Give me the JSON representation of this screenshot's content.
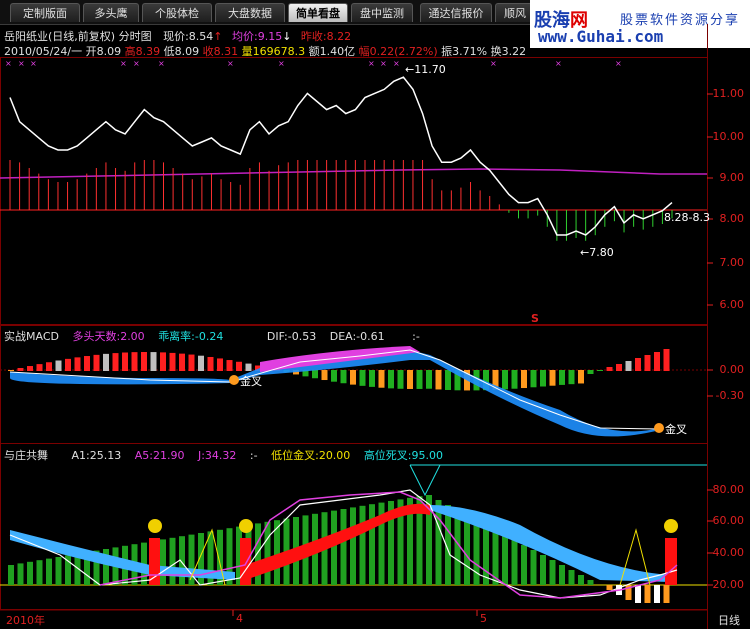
{
  "tabs": [
    {
      "label": "定制版面"
    },
    {
      "label": "多头鹰"
    },
    {
      "label": "个股体检"
    },
    {
      "label": "大盘数据"
    },
    {
      "label": "简单看盘",
      "active": true
    },
    {
      "label": "盘中监测"
    },
    {
      "label": "通达信报价"
    },
    {
      "label": "顺风"
    }
  ],
  "watermark": {
    "brand_cn_a": "股海",
    "brand_cn_b": "网",
    "slogan": "股票软件资源分享",
    "url": "www.Guhai.com"
  },
  "stock_header": {
    "name": "岳阳纸业(日线,前复权) 分时图",
    "price_label": "现价:8.54",
    "avg_label": "均价:9.15",
    "prev_close_label": "昨收:8.22"
  },
  "quote_row": {
    "date": "2010/05/24/一",
    "open": "开8.09",
    "high": "高8.39",
    "low": "低8.09",
    "close": "收8.31",
    "volume": "量169678.3",
    "amount": "额1.40亿",
    "change": "幅0.22(2.72%)",
    "amplitude": "振3.71%",
    "turnover": "换3.22"
  },
  "main_chart": {
    "y_ticks": [
      "11.00",
      "10.00",
      "9.00",
      "8.00",
      "7.00",
      "6.00"
    ],
    "high_marker": "11.70",
    "low_marker": "7.80",
    "range_label": "8.28-8.3",
    "sell_marker": "S"
  },
  "macd_panel": {
    "name": "实战MACD",
    "bull_days": "多头天数:2.00",
    "deviation": "乖离率:-0.24",
    "dif": "DIF:-0.53",
    "dea": "DEA:-0.61",
    "extra": ":-",
    "y_ticks": [
      "0.00",
      "-0.30"
    ],
    "cross_label_1": "金叉",
    "cross_label_2": "金叉"
  },
  "dance_panel": {
    "name": "与庄共舞",
    "a1": "A1:25.13",
    "a5": "A5:21.90",
    "j": "J:34.32",
    "extra": ":-",
    "low_cross": "低位金叉:20.00",
    "high_cross": "高位死叉:95.00",
    "y_ticks": [
      "80.00",
      "60.00",
      "40.00",
      "20.00"
    ]
  },
  "x_axis": {
    "labels": [
      "2010年",
      "4",
      "5"
    ],
    "period": "日线"
  },
  "chart_data": {
    "type": "line",
    "series": [
      {
        "values": [
          11.2,
          10.6,
          10.4,
          10.2,
          10.0,
          9.9,
          9.9,
          10.0,
          10.2,
          10.4,
          10.6,
          10.4,
          10.3,
          10.6,
          10.9,
          10.7,
          10.6,
          10.4,
          10.2,
          10.0,
          10.1,
          10.2,
          10.0,
          9.9,
          9.8,
          10.4,
          10.6,
          10.3,
          10.5,
          10.6,
          11.0,
          11.3,
          11.1,
          10.9,
          11.0,
          10.8,
          10.9,
          11.2,
          11.3,
          11.4,
          11.6,
          11.7,
          11.4,
          10.8,
          10.0,
          9.6,
          9.6,
          9.7,
          9.9,
          9.6,
          9.4,
          9.1,
          8.8,
          8.6,
          8.6,
          8.7,
          8.3,
          7.8,
          7.8,
          7.9,
          7.8,
          8.0,
          8.3,
          8.5,
          8.1,
          8.3,
          8.2,
          8.3,
          8.4,
          8.6
        ]
      }
    ],
    "ylim": [
      5.6,
      12.2
    ]
  }
}
